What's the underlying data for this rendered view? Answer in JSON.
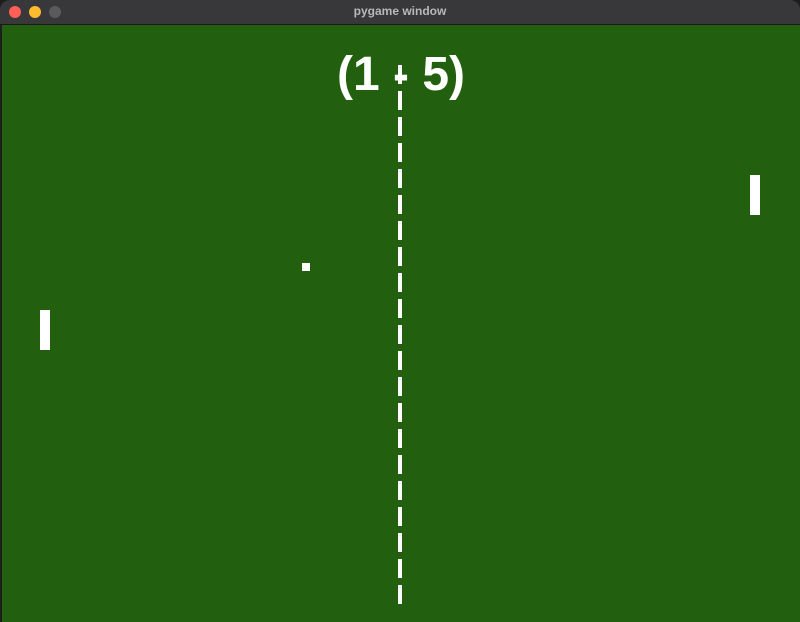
{
  "window": {
    "title": "pygame window"
  },
  "game": {
    "score_text": "(1 - 5)",
    "field_color": "#225f0e",
    "foreground_color": "#ffffff"
  },
  "icons": {
    "close": "close-traffic-light",
    "minimize": "minimize-traffic-light",
    "zoom": "zoom-traffic-light"
  }
}
